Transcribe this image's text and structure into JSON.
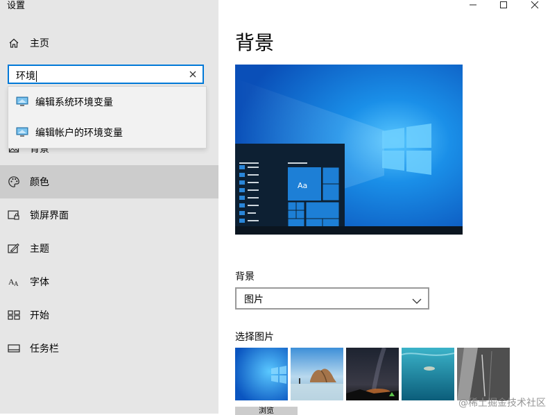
{
  "window": {
    "title": "设置"
  },
  "sidebar": {
    "home": "主页",
    "search": {
      "value": "环境"
    },
    "suggestions": [
      "编辑系统环境变量",
      "编辑帐户的环境变量"
    ],
    "items": [
      {
        "label": "背景"
      },
      {
        "label": "颜色"
      },
      {
        "label": "锁屏界面"
      },
      {
        "label": "主题"
      },
      {
        "label": "字体"
      },
      {
        "label": "开始"
      },
      {
        "label": "任务栏"
      }
    ]
  },
  "main": {
    "title": "背景",
    "preview_tile_text": "Aa",
    "background_label": "背景",
    "background_value": "图片",
    "choose_label": "选择图片",
    "browse_label": "浏览"
  },
  "watermark": "@稀土掘金技术社区",
  "colors": {
    "accent": "#0078d7",
    "sidebar_bg": "#e6e6e6",
    "selected_bg": "#cccccc"
  }
}
